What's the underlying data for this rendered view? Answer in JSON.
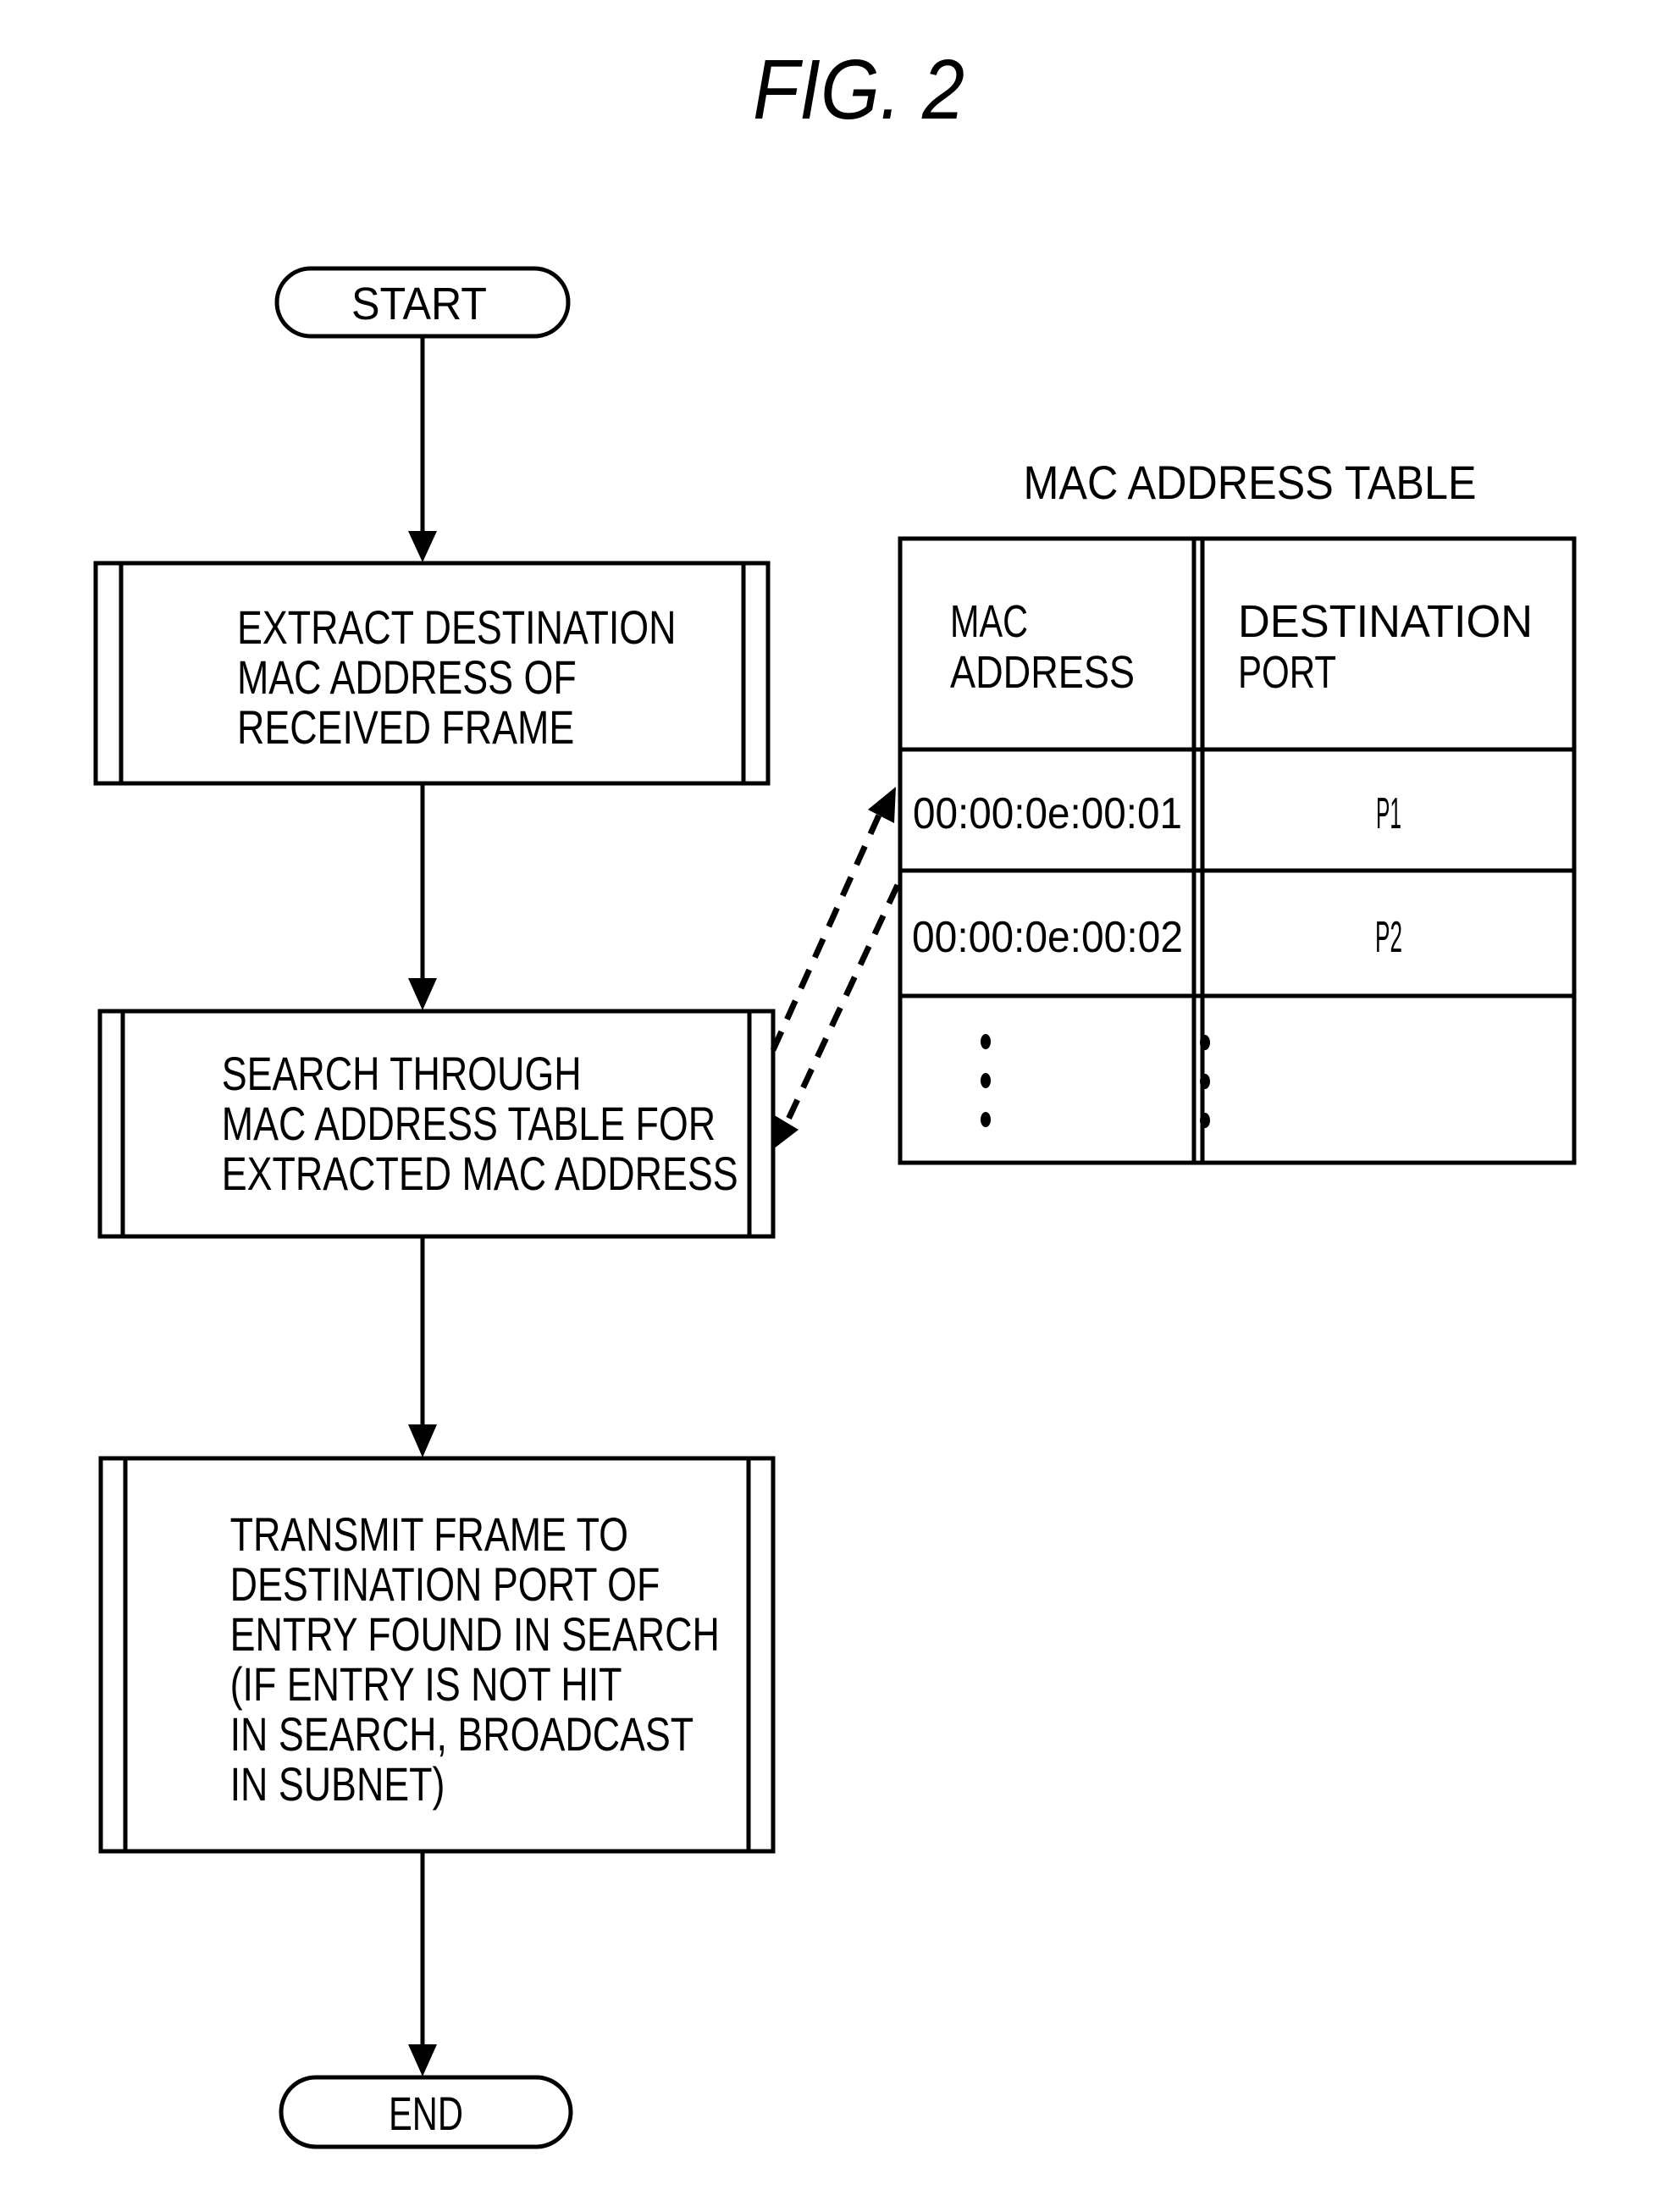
{
  "figure": {
    "title": "FIG. 2"
  },
  "flowchart": {
    "start_label": "START",
    "end_label": "END",
    "steps": [
      {
        "lines": [
          "EXTRACT DESTINATION",
          "MAC ADDRESS OF",
          "RECEIVED FRAME"
        ]
      },
      {
        "lines": [
          "SEARCH THROUGH",
          "MAC ADDRESS TABLE FOR",
          "EXTRACTED MAC ADDRESS"
        ]
      },
      {
        "lines": [
          "TRANSMIT FRAME TO",
          "DESTINATION  PORT OF",
          "ENTRY FOUND IN SEARCH",
          "(IF ENTRY IS NOT HIT",
          "IN SEARCH, BROADCAST",
          "IN SUBNET)"
        ]
      }
    ]
  },
  "mac_table": {
    "title": "MAC ADDRESS TABLE",
    "headers": [
      [
        "MAC",
        "ADDRESS"
      ],
      [
        "DESTINATION",
        "PORT"
      ]
    ],
    "rows": [
      {
        "mac": "00:00:0e:00:01",
        "port": "P1"
      },
      {
        "mac": "00:00:0e:00:02",
        "port": "P2"
      }
    ],
    "continuation": "⋮"
  }
}
